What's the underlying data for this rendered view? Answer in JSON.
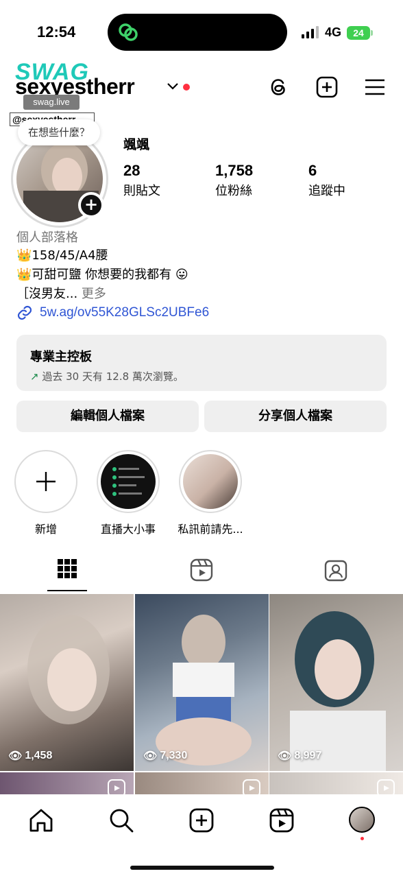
{
  "status_bar": {
    "time": "12:54",
    "network": "4G",
    "battery": "24"
  },
  "watermark": {
    "title": "SWAG",
    "url": "swag.live",
    "handle": "@sexyestherr"
  },
  "header": {
    "username": "sexyestherr"
  },
  "note": {
    "text": "在想些什麼？"
  },
  "profile": {
    "display_name": "颯颯",
    "stats": [
      {
        "value": "28",
        "label": "則貼文"
      },
      {
        "value": "1,758",
        "label": "位粉絲"
      },
      {
        "value": "6",
        "label": "追蹤中"
      }
    ],
    "category": "個人部落格",
    "bio": [
      "158/45/A4腰",
      "可甜可鹽 你想要的我都有",
      "［沒男友..."
    ],
    "bio_more": "更多",
    "link": "5w.ag/ov55K28GLSc2UBFe6"
  },
  "dashboard": {
    "title": "專業主控板",
    "subtitle": "過去 30 天有 12.8 萬次瀏覽。"
  },
  "buttons": {
    "edit": "編輯個人檔案",
    "share": "分享個人檔案"
  },
  "highlights": [
    {
      "label": "新增"
    },
    {
      "label": "直播大小事"
    },
    {
      "label": "私訊前請先..."
    }
  ],
  "posts": [
    {
      "views": "1,458"
    },
    {
      "views": "7,330"
    },
    {
      "views": "8,997"
    }
  ],
  "icons": {
    "threads": "threads-icon",
    "new_post": "plus-square-icon",
    "menu": "hamburger-menu-icon",
    "grid": "grid-icon",
    "reels": "reels-icon",
    "tagged": "tagged-icon",
    "home": "home-icon",
    "search": "search-icon",
    "create": "create-icon",
    "reels_nav": "reels-icon"
  },
  "colors": {
    "link": "#2f55d4",
    "notification": "#ff3040",
    "watermark": "#1fc9b8",
    "battery": "#3fcf50"
  }
}
